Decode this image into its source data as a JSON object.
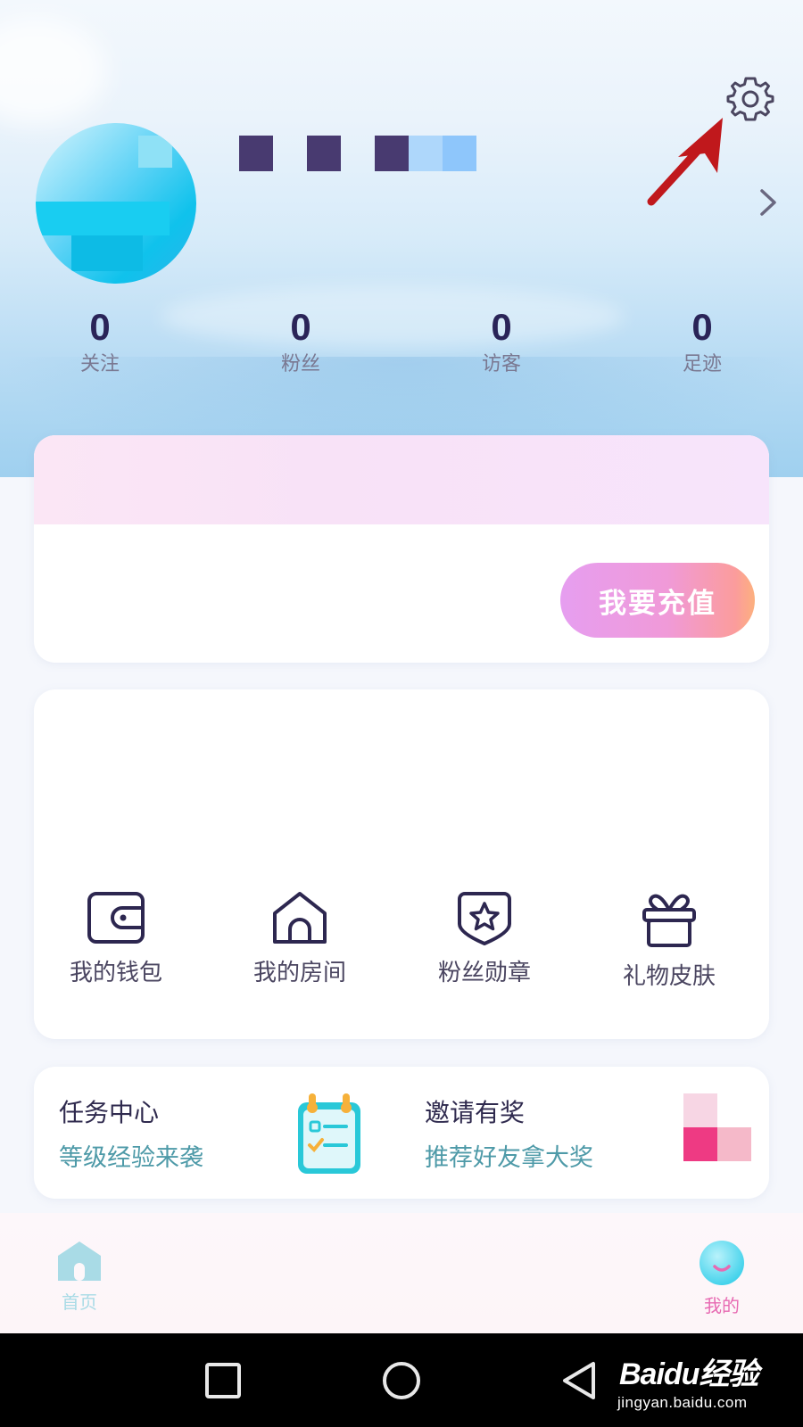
{
  "profile": {
    "stats": [
      {
        "value": "0",
        "label": "关注"
      },
      {
        "value": "0",
        "label": "粉丝"
      },
      {
        "value": "0",
        "label": "访客"
      },
      {
        "value": "0",
        "label": "足迹"
      }
    ]
  },
  "recharge": {
    "button_label": "我要充值"
  },
  "features": [
    {
      "label": "我的钱包",
      "icon": "wallet-icon"
    },
    {
      "label": "我的房间",
      "icon": "house-icon"
    },
    {
      "label": "粉丝勋章",
      "icon": "badge-star-icon"
    },
    {
      "label": "礼物皮肤",
      "icon": "gift-icon"
    }
  ],
  "promos": {
    "task": {
      "title": "任务中心",
      "subtitle": "等级经验来袭",
      "icon": "task-calendar-icon"
    },
    "invite": {
      "title": "邀请有奖",
      "subtitle": "推荐好友拿大奖"
    }
  },
  "tabbar": {
    "home_label": "首页",
    "mine_label": "我的",
    "active": "mine",
    "colors": {
      "home": "#a9dbe6",
      "mine": "#e76ab2"
    }
  },
  "system_nav": {
    "buttons": [
      "recent-apps",
      "home",
      "back"
    ]
  },
  "watermark": {
    "brand": "Baidu经验",
    "url": "jingyan.baidu.com"
  },
  "colors": {
    "accent_dark": "#2a2458",
    "subtitle_teal": "#4e9aa8",
    "annotation_arrow": "#c0181c"
  }
}
